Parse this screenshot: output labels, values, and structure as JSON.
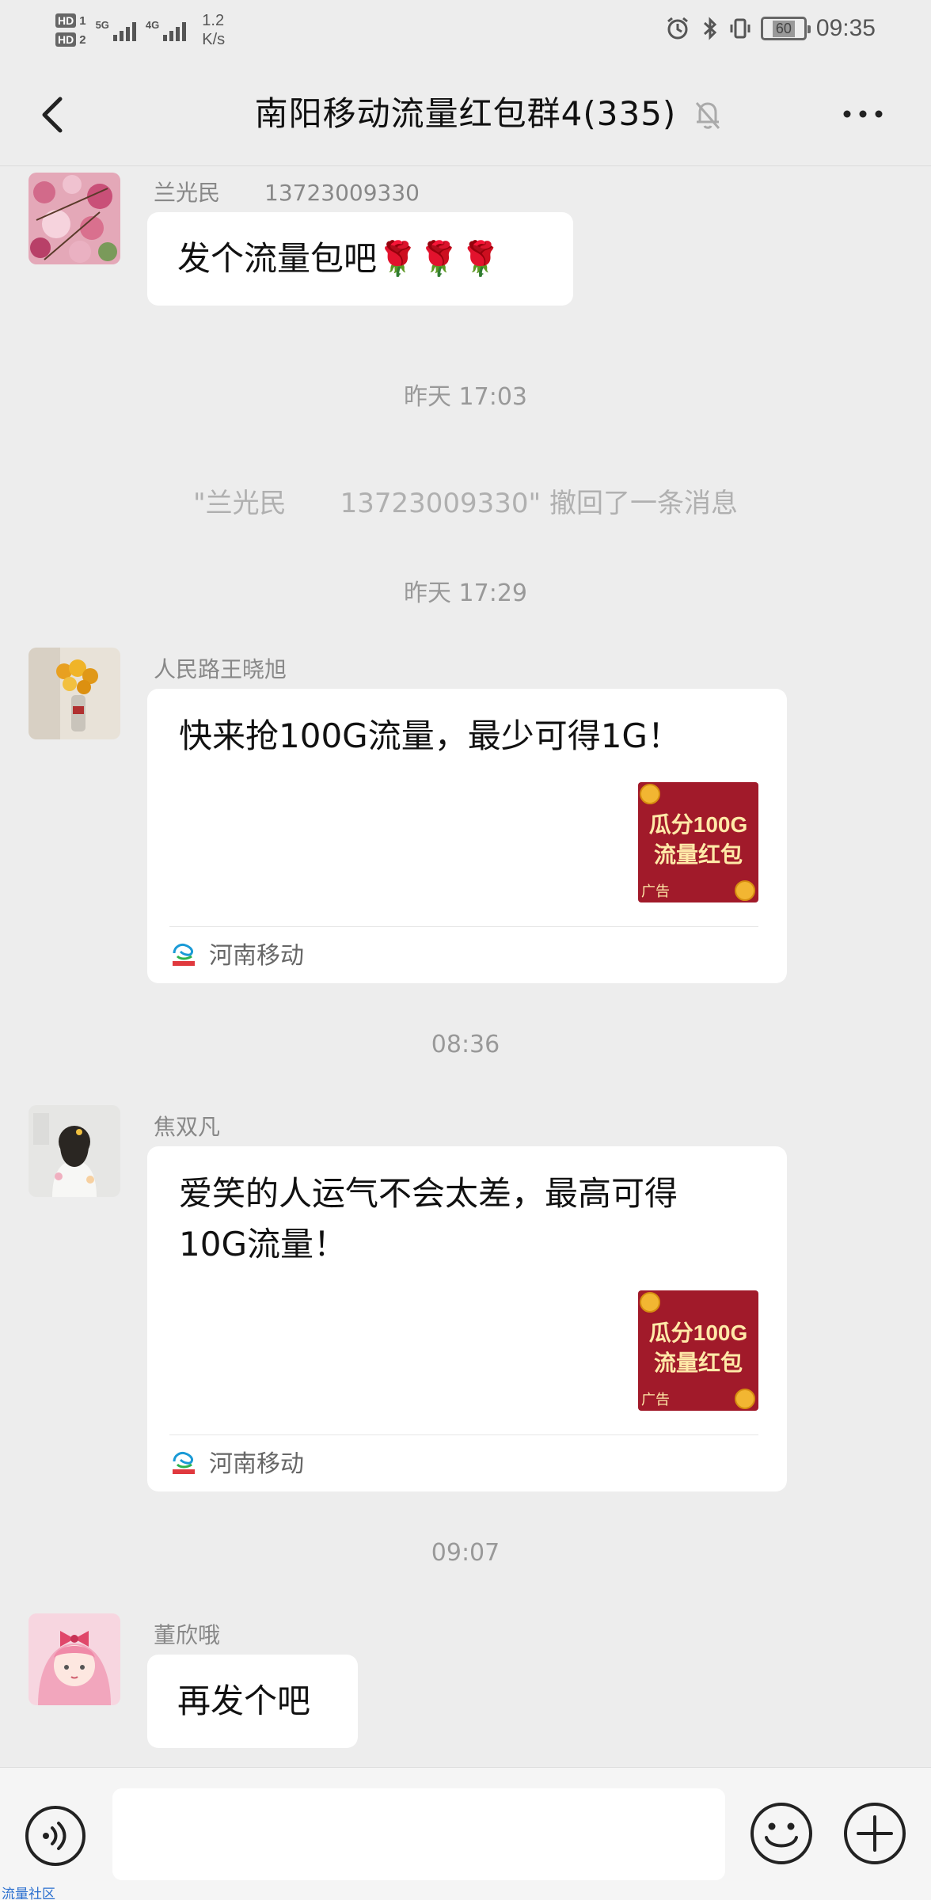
{
  "status_bar": {
    "sim1": {
      "badge": "HD",
      "num": "1",
      "network": "5G"
    },
    "sim2": {
      "badge": "HD",
      "num": "2",
      "network": "4G"
    },
    "speed_value": "1.2",
    "speed_unit": "K/s",
    "battery": "60",
    "time": "09:35",
    "icons": [
      "alarm-icon",
      "bluetooth-icon",
      "vibrate-icon",
      "battery-icon"
    ]
  },
  "header": {
    "title": "南阳移动流量红包群4(335)",
    "icons": [
      "back-arrow-icon",
      "mute-bell-icon",
      "more-dots-icon"
    ]
  },
  "messages": {
    "m1": {
      "sender": "兰光民　　13723009330",
      "text": "发个流量包吧🌹🌹🌹"
    },
    "ts1": "昨天 17:03",
    "recall": "\"兰光民　　13723009330\" 撤回了一条消息",
    "ts2": "昨天 17:29",
    "m2": {
      "sender": "人民路王晓旭",
      "text": "快来抢100G流量，最少可得1G！",
      "ad_line1": "瓜分100G",
      "ad_line2": "流量红包",
      "ad_tag": "广告",
      "source": "河南移动"
    },
    "ts3": "08:36",
    "m3": {
      "sender": "焦双凡",
      "text_line1": "爱笑的人运气不会太差，最高可得",
      "text_line2": "10G流量！",
      "ad_line1": "瓜分100G",
      "ad_line2": "流量红包",
      "ad_tag": "广告",
      "source": "河南移动"
    },
    "ts4": "09:07",
    "m4": {
      "sender": "董欣哦",
      "text": "再发个吧"
    }
  },
  "input_bar": {
    "placeholder": "",
    "icons": [
      "voice-icon",
      "emoji-icon",
      "plus-icon"
    ]
  },
  "watermark": "流量社区",
  "colors": {
    "background": "#ededed",
    "bubble": "#ffffff",
    "ad_red": "#a11a2a",
    "muted_text": "#999999"
  }
}
